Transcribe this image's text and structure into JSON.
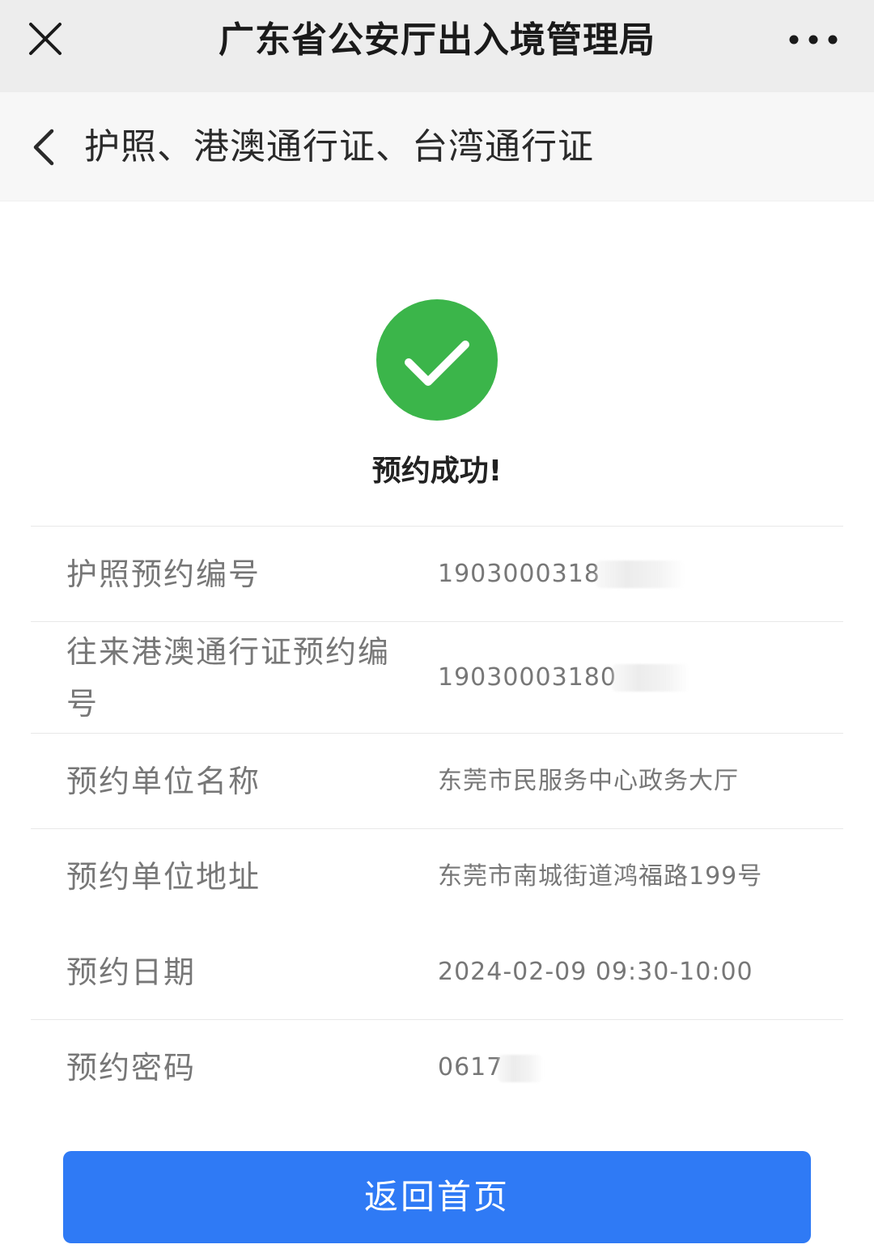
{
  "topbar": {
    "title": "广东省公安厅出入境管理局",
    "close_icon": "close-icon",
    "more_icon": "more-horizontal-icon"
  },
  "subheader": {
    "title": "护照、港澳通行证、台湾通行证",
    "back_icon": "chevron-left-icon"
  },
  "result": {
    "icon": "check-circle-icon",
    "icon_color": "#3bb54a",
    "message": "预约成功!"
  },
  "info": [
    {
      "label": "护照预约编号",
      "value": "1903000318"
    },
    {
      "label": "往来港澳通行证预约编号",
      "value": "19030003180"
    },
    {
      "label": "预约单位名称",
      "value": "东莞市民服务中心政务大厅"
    },
    {
      "label": "预约单位地址",
      "value": "东莞市南城街道鸿福路199号"
    },
    {
      "label": "预约日期",
      "value": "2024-02-09 09:30-10:00"
    },
    {
      "label": "预约密码",
      "value": "0617"
    }
  ],
  "button": {
    "label": "返回首页",
    "color": "#2f7af5"
  }
}
